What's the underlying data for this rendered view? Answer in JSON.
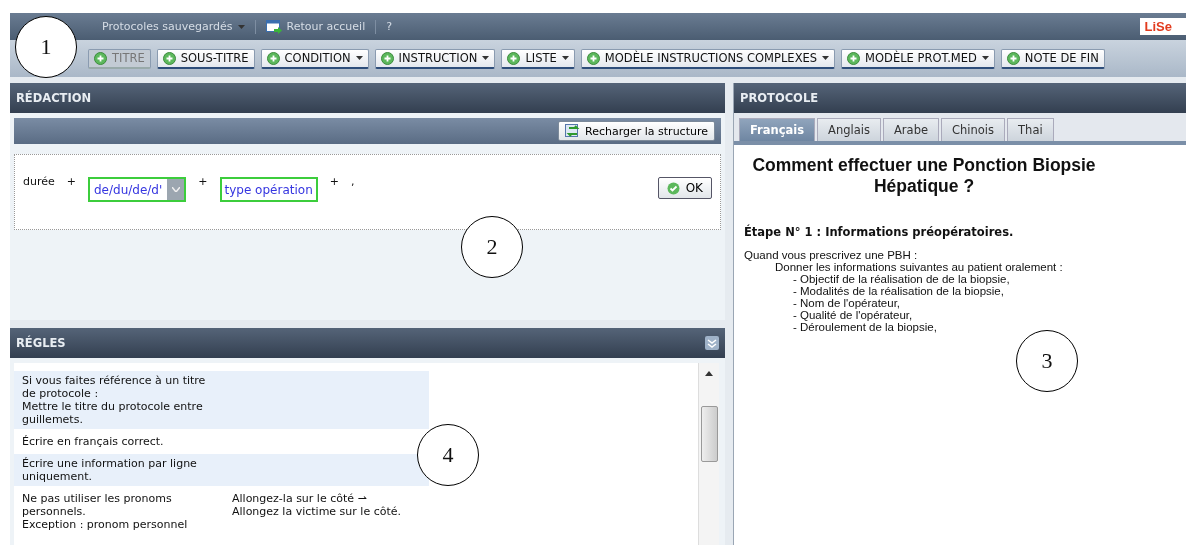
{
  "menu_bar": {
    "items": [
      {
        "label": "Protocoles sauvegardés",
        "kind": "dropdown"
      },
      {
        "label": "Retour accueil",
        "kind": "icon"
      },
      {
        "label": "?",
        "kind": "plain"
      }
    ],
    "logo": "LiSe"
  },
  "toolbar": {
    "buttons": [
      {
        "label": "TITRE",
        "disabled": true,
        "dropdown": false
      },
      {
        "label": "SOUS-TITRE",
        "disabled": false,
        "dropdown": false
      },
      {
        "label": "CONDITION",
        "disabled": false,
        "dropdown": true
      },
      {
        "label": "INSTRUCTION",
        "disabled": false,
        "dropdown": true
      },
      {
        "label": "LISTE",
        "disabled": false,
        "dropdown": true
      },
      {
        "label": "MODÈLE INSTRUCTIONS COMPLEXES",
        "disabled": false,
        "dropdown": true
      },
      {
        "label": "MODÈLE PROT.MED",
        "disabled": false,
        "dropdown": true
      },
      {
        "label": "NOTE DE FIN",
        "disabled": false,
        "dropdown": false
      }
    ]
  },
  "redaction": {
    "title": "RÉDACTION",
    "reload_button": "Recharger la structure",
    "tokens": [
      {
        "kind": "word",
        "text": "durée"
      },
      {
        "kind": "plus",
        "text": "+"
      },
      {
        "kind": "select",
        "text": "de/du/de/d'"
      },
      {
        "kind": "plus",
        "text": "+"
      },
      {
        "kind": "field",
        "text": "type opération"
      },
      {
        "kind": "plus",
        "text": "+"
      },
      {
        "kind": "word",
        "text": ","
      }
    ],
    "ok_button": "OK"
  },
  "regles": {
    "title": "RÉGLES",
    "rows": [
      {
        "rule": [
          "Si vous faites référence à un titre",
          "de protocole :",
          "Mettre le titre du protocole entre",
          "guillemets."
        ],
        "example": []
      },
      {
        "rule": [
          "Écrire en français correct."
        ],
        "example": []
      },
      {
        "rule": [
          "Écrire une information par ligne",
          "uniquement."
        ],
        "example": []
      },
      {
        "rule": [
          "Ne pas utiliser les pronoms",
          "personnels.",
          "Exception : pronom personnel"
        ],
        "example": [
          "Allongez-la sur le côté ⇀",
          "Allongez la victime sur le côté."
        ]
      }
    ]
  },
  "protocole": {
    "title": "PROTOCOLE",
    "tabs": [
      {
        "label": "Français",
        "selected": true
      },
      {
        "label": "Anglais",
        "selected": false
      },
      {
        "label": "Arabe",
        "selected": false
      },
      {
        "label": "Chinois",
        "selected": false
      },
      {
        "label": "Thai",
        "selected": false
      }
    ],
    "heading": "Comment effectuer une Ponction Biopsie Hépatique ?",
    "step": "Étape N° 1 : Informations préopératoires.",
    "lines": [
      {
        "text": "Quand vous prescrivez une PBH :",
        "children": [
          {
            "text": "Donner les informations suivantes au patient oralement :",
            "children": [
              {
                "text": "- Objectif de la réalisation de de la biopsie,"
              },
              {
                "text": "- Modalités de la réalisation de la biopsie,"
              },
              {
                "text": "- Nom de l'opérateur,"
              },
              {
                "text": "- Qualité de l'opérateur,"
              },
              {
                "text": "- Déroulement de la biopsie,"
              }
            ]
          }
        ]
      }
    ]
  },
  "callouts": [
    "1",
    "2",
    "3",
    "4"
  ]
}
